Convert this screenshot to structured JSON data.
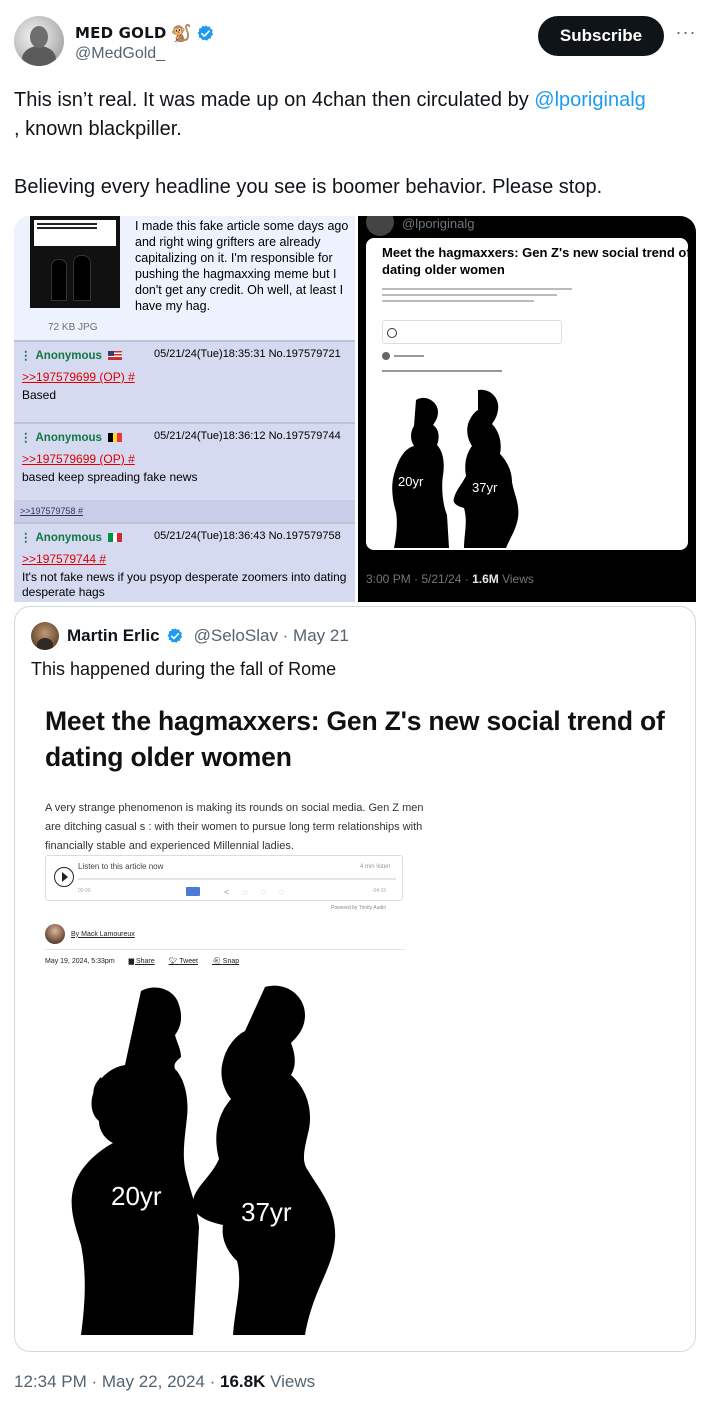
{
  "author": {
    "display_name": "MED GOLD",
    "name_emoji": "🐒",
    "handle": "@MedGold_",
    "verified_icon": "verified-badge-icon"
  },
  "actions": {
    "subscribe_label": "Subscribe",
    "more_label": "···"
  },
  "tweet": {
    "line1_prefix": "This isn’t real. It was made up on 4chan then circulated by ",
    "mention": "@lporiginalg",
    "line1_suffix": ", known blackpiller.",
    "line2": "Believing every headline you see is boomer behavior. Please stop."
  },
  "chan_screenshot": {
    "op_text": "I made this fake article some days ago and right wing grifters are already capitalizing on it. I'm responsible for pushing the hagmaxxing meme but I don't get any credit. Oh well, at least I have my hag.",
    "thumb_size": "72 KB JPG",
    "replies": [
      {
        "name": "Anonymous",
        "meta": "05/21/24(Tue)18:35:31 No.197579721",
        "quote": ">>197579699 (OP) #",
        "message": "Based",
        "flag_colors": [
          "#3c3b6e",
          "#e06c2c"
        ]
      },
      {
        "name": "Anonymous",
        "meta": "05/21/24(Tue)18:36:12 No.197579744",
        "quote": ">>197579699 (OP) #",
        "message": "based keep spreading fake news",
        "flag_colors": [
          "#000000",
          "#fdda24",
          "#ef3340"
        ]
      },
      {
        "name": "Anonymous",
        "meta": "05/21/24(Tue)18:36:43 No.197579758",
        "quote": ">>197579744 #",
        "message": "It's not fake news if you psyop desperate zoomers into dating desperate hags",
        "flag_colors": [
          "#009246",
          "#ffffff",
          "#ce2b37"
        ]
      }
    ],
    "backlink": ">>197579758 #"
  },
  "repost_screenshot": {
    "handle": "@lporiginalg",
    "article_title": "Meet the hagmaxxers: Gen Z's new social trend of dating older women",
    "age_left": "20yr",
    "age_right": "37yr",
    "time": "3:00 PM · 5/21/24 · ",
    "views_count": "1.6M",
    "views_label": " Views"
  },
  "quoted_tweet": {
    "name": "Martin Erlic",
    "handle": "@SeloSlav · May 21",
    "text": "This happened during the fall of Rome",
    "article": {
      "title": "Meet the hagmaxxers: Gen Z's new social trend of dating older women",
      "paragraph": "A very strange phenomenon is making its rounds on social media. Gen Z men are ditching casual s  : with their women to pursue long term relationships with financially stable and experienced Millennial ladies.",
      "player_label": "Listen to this article now",
      "player_duration": "4 min listen",
      "player_start": "00:00",
      "player_end": "-04:15",
      "powered_by": "Powered by Trinity Audio",
      "byline": "By Mack Lamoureux",
      "date": "May 19, 2024, 5:33pm",
      "share_labels": [
        "Share",
        "Tweet",
        "Snap"
      ],
      "age_left": "20yr",
      "age_right": "37yr"
    }
  },
  "footer": {
    "timestamp": "12:34 PM · May 22, 2024 · ",
    "views_count": "16.8K",
    "views_label": " Views"
  },
  "colors": {
    "link": "#1d9bf0",
    "secondary_text": "#536471",
    "chan_bg": "#d6daf0",
    "chan_name": "#117743",
    "chan_quote": "#dd0000"
  }
}
